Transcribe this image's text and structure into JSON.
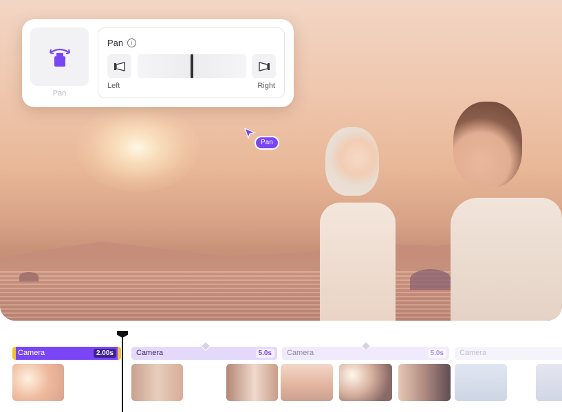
{
  "preset": {
    "label": "Pan",
    "icon": "camera-pan-icon"
  },
  "pan_control": {
    "title": "Pan",
    "info_icon": "info-icon",
    "left_label": "Left",
    "right_label": "Right",
    "slider_value_fraction": 0.5
  },
  "cursor": {
    "tag": "Pan"
  },
  "timeline": {
    "camera_tracks": [
      {
        "label": "Camera",
        "duration": "2.00s"
      },
      {
        "label": "Camera",
        "duration": "5.0s"
      },
      {
        "label": "Camera",
        "duration": "5.0s"
      },
      {
        "label": "Camera",
        "duration": ""
      }
    ]
  },
  "colors": {
    "accent": "#7a45f5",
    "handle": "#f3c234"
  }
}
